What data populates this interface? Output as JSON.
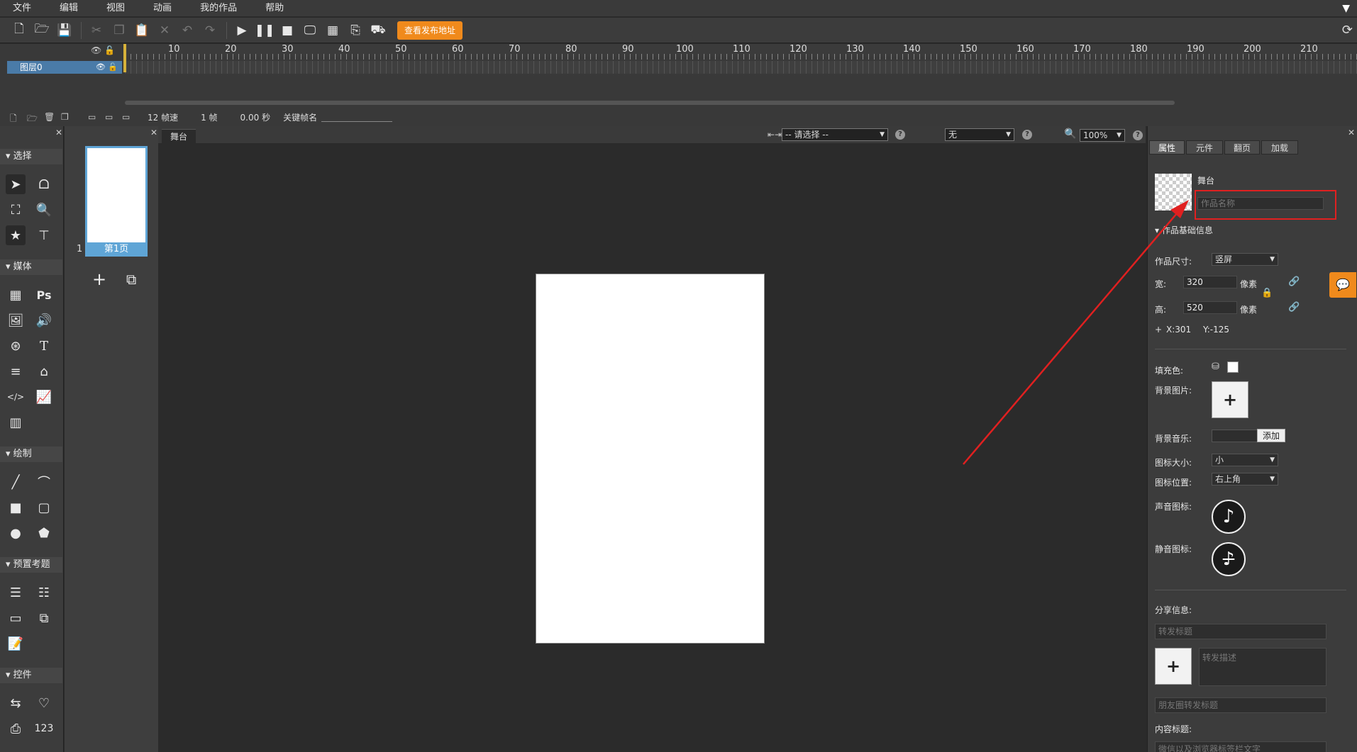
{
  "menu": [
    "文件",
    "编辑",
    "视图",
    "动画",
    "我的作品",
    "帮助"
  ],
  "toolbar": {
    "publish_label": "查看发布地址"
  },
  "timeline": {
    "ticks": [
      "10",
      "20",
      "30",
      "40",
      "50",
      "60",
      "70",
      "80",
      "90",
      "100",
      "110",
      "120",
      "130",
      "140",
      "150",
      "160",
      "170",
      "180",
      "190",
      "200",
      "210"
    ],
    "layer_name": "图层0",
    "status": {
      "fps": "12 帧速",
      "frame": "1 帧",
      "time": "0.00 秒",
      "keyframe_label": "关键帧名"
    }
  },
  "tools": {
    "cat_select": "选择",
    "cat_media": "媒体",
    "cat_draw": "绘制",
    "cat_preset": "预置考题",
    "cat_controls": "控件"
  },
  "pages": {
    "page1_label": "第1页",
    "page1_num": "1"
  },
  "stage": {
    "tab": "舞台",
    "select_placeholder": "-- 请选择 --",
    "effect_value": "无",
    "zoom": "100%"
  },
  "props": {
    "tabs": [
      "属性",
      "元件",
      "翻页",
      "加载"
    ],
    "stage_label": "舞台",
    "name_placeholder": "作品名称",
    "section_basic": "作品基础信息",
    "size_label": "作品尺寸:",
    "size_value": "竖屏",
    "width_label": "宽:",
    "width_value": "320",
    "height_label": "高:",
    "height_value": "520",
    "unit": "像素",
    "coords_x": "X:301",
    "coords_y": "Y:-125",
    "fill_label": "填充色:",
    "bg_image_label": "背景图片:",
    "bg_music_label": "背景音乐:",
    "add_label": "添加",
    "icon_size_label": "图标大小:",
    "icon_size_value": "小",
    "icon_pos_label": "图标位置:",
    "icon_pos_value": "右上角",
    "sound_icon_label": "声音图标:",
    "mute_icon_label": "静音图标:",
    "share_label": "分享信息:",
    "share_title_placeholder": "转发标题",
    "share_desc_placeholder": "转发描述",
    "moments_title_placeholder": "朋友圈转发标题",
    "content_title_label": "内容标题:",
    "content_title_placeholder": "微信以及浏览器标签栏文字"
  },
  "colors": {
    "accent": "#f08a1c",
    "selection": "#5fa5d6",
    "highlight": "#e02020"
  }
}
